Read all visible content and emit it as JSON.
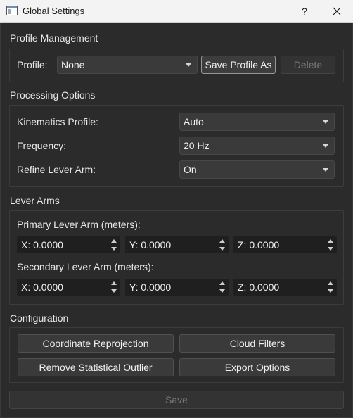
{
  "window": {
    "title": "Global Settings",
    "help_label": "?",
    "close_label": "✕"
  },
  "profile_management": {
    "section_title": "Profile Management",
    "profile_label": "Profile:",
    "profile_value": "None",
    "save_as_label": "Save Profile As",
    "delete_label": "Delete"
  },
  "processing_options": {
    "section_title": "Processing Options",
    "kinematics_label": "Kinematics Profile:",
    "kinematics_value": "Auto",
    "frequency_label": "Frequency:",
    "frequency_value": "20 Hz",
    "refine_label": "Refine Lever Arm:",
    "refine_value": "On"
  },
  "lever_arms": {
    "section_title": "Lever Arms",
    "primary_label": "Primary Lever Arm (meters):",
    "primary": {
      "x": "X: 0.0000",
      "y": "Y: 0.0000",
      "z": "Z: 0.0000"
    },
    "secondary_label": "Secondary Lever Arm (meters):",
    "secondary": {
      "x": "X: 0.0000",
      "y": "Y: 0.0000",
      "z": "Z: 0.0000"
    }
  },
  "configuration": {
    "section_title": "Configuration",
    "coordinate_reprojection": "Coordinate Reprojection",
    "cloud_filters": "Cloud Filters",
    "remove_outlier": "Remove Statistical Outlier",
    "export_options": "Export Options"
  },
  "footer": {
    "save_label": "Save"
  }
}
